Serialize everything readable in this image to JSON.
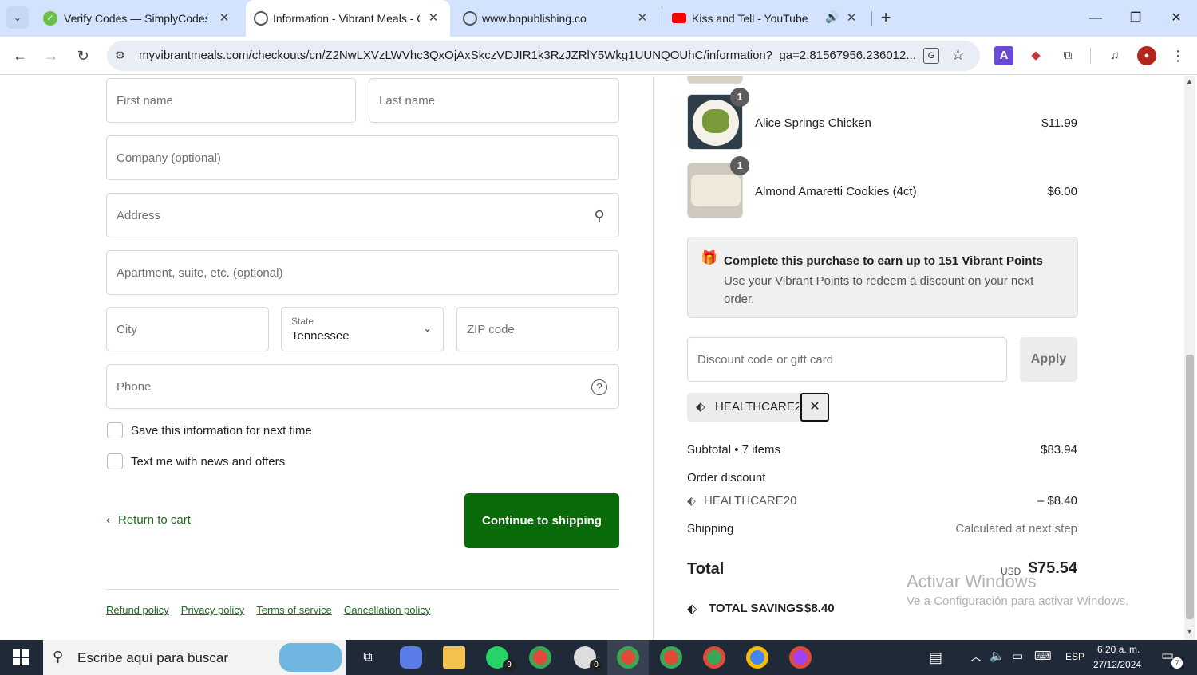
{
  "browser": {
    "tabs": [
      {
        "title": "Verify Codes — SimplyCodes",
        "icon": "simplycodes-icon"
      },
      {
        "title": "Information - Vibrant Meals - C",
        "icon": "globe-icon"
      },
      {
        "title": "www.bnpublishing.co",
        "icon": "globe-icon"
      },
      {
        "title": "Kiss and Tell - YouTube",
        "icon": "youtube-icon"
      }
    ],
    "new_tab": "+",
    "url": "myvibrantmeals.com/checkouts/cn/Z2NwLXVzLWVhc3QxOjAxSkczVDJIR1k3RzJZRlY5Wkg1UUNQOUhC/information?_ga=2.81567956.236012..."
  },
  "form": {
    "first_name": "First name",
    "last_name": "Last name",
    "company": "Company (optional)",
    "address": "Address",
    "apartment": "Apartment, suite, etc. (optional)",
    "city": "City",
    "state_label": "State",
    "state_value": "Tennessee",
    "zip": "ZIP code",
    "phone": "Phone",
    "save_info": "Save this information for next time",
    "text_me": "Text me with news and offers",
    "return_to_cart": "Return to cart",
    "continue": "Continue to shipping"
  },
  "footer_links": [
    "Refund policy",
    "Privacy policy",
    "Terms of service",
    "Cancellation policy"
  ],
  "summary": {
    "items": [
      {
        "qty": "1",
        "name": "Alice Springs Chicken",
        "price": "$11.99"
      },
      {
        "qty": "1",
        "name": "Almond Amaretti Cookies (4ct)",
        "price": "$6.00"
      }
    ],
    "points_title": "Complete this purchase to earn up to 151 Vibrant Points",
    "points_body": "Use your Vibrant Points to redeem a discount on your next order.",
    "discount_placeholder": "Discount code or gift card",
    "apply": "Apply",
    "applied_code": "HEALTHCARE20",
    "subtotal_label": "Subtotal • 7 items",
    "subtotal_value": "$83.94",
    "order_discount_label": "Order discount",
    "discount_code": "HEALTHCARE20",
    "discount_value": "– $8.40",
    "shipping_label": "Shipping",
    "shipping_value": "Calculated at next step",
    "total_label": "Total",
    "currency": "USD",
    "total_value": "$75.54",
    "savings_label": "TOTAL SAVINGS",
    "savings_value": "$8.40"
  },
  "watermark": {
    "title": "Activar Windows",
    "body": "Ve a Configuración para activar Windows."
  },
  "taskbar": {
    "search_placeholder": "Escribe aquí para buscar",
    "lang": "ESP",
    "time": "6:20 a. m.",
    "date": "27/12/2024",
    "notifications": "7",
    "whatsapp_badge": "9",
    "app_badge": "0"
  },
  "colors": {
    "accent": "#0a6b0a",
    "tabbar": "#d3e3fd",
    "taskbar": "#1f2937"
  }
}
